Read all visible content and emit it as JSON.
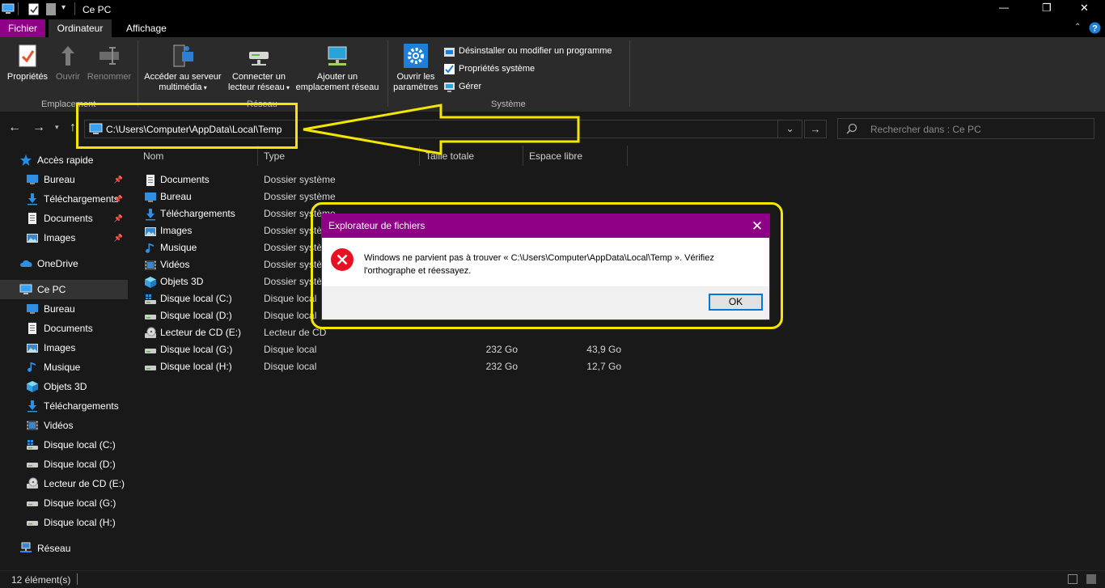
{
  "window": {
    "title": "Ce PC",
    "controls": {
      "minimize": "—",
      "restore": "❐",
      "close": "✕"
    }
  },
  "ribbon_tabs": [
    "Fichier",
    "Ordinateur",
    "Affichage"
  ],
  "ribbon": {
    "location": {
      "group_label": "Emplacement",
      "properties": "Propriétés",
      "open": "Ouvrir",
      "rename": "Renommer"
    },
    "network": {
      "group_label": "Réseau",
      "media_server_line1": "Accéder au serveur",
      "media_server_line2": "multimédia",
      "map_drive_line1": "Connecter un",
      "map_drive_line2": "lecteur réseau",
      "add_location_line1": "Ajouter un",
      "add_location_line2": "emplacement réseau"
    },
    "system": {
      "group_label": "Système",
      "open_settings_line1": "Ouvrir les",
      "open_settings_line2": "paramètres",
      "uninstall": "Désinstaller ou modifier un programme",
      "sys_props": "Propriétés système",
      "manage": "Gérer"
    }
  },
  "address": {
    "path": "C:\\Users\\Computer\\AppData\\Local\\Temp",
    "search_placeholder": "Rechercher dans : Ce PC"
  },
  "nav_pane": [
    {
      "label": "Accès rapide",
      "icon": "star-icon",
      "level": 0,
      "pinned": false
    },
    {
      "label": "Bureau",
      "icon": "desktop-icon",
      "level": 1,
      "pinned": true
    },
    {
      "label": "Téléchargements",
      "icon": "download-icon",
      "level": 1,
      "pinned": true
    },
    {
      "label": "Documents",
      "icon": "document-icon",
      "level": 1,
      "pinned": true
    },
    {
      "label": "Images",
      "icon": "image-icon",
      "level": 1,
      "pinned": true
    },
    {
      "label": "OneDrive",
      "icon": "cloud-icon",
      "level": 0,
      "pinned": false
    },
    {
      "label": "Ce PC",
      "icon": "computer-icon",
      "level": 0,
      "pinned": false,
      "selected": true
    },
    {
      "label": "Bureau",
      "icon": "desktop-icon",
      "level": 1,
      "pinned": false
    },
    {
      "label": "Documents",
      "icon": "document-icon",
      "level": 1,
      "pinned": false
    },
    {
      "label": "Images",
      "icon": "image-icon",
      "level": 1,
      "pinned": false
    },
    {
      "label": "Musique",
      "icon": "music-icon",
      "level": 1,
      "pinned": false
    },
    {
      "label": "Objets 3D",
      "icon": "cube-icon",
      "level": 1,
      "pinned": false
    },
    {
      "label": "Téléchargements",
      "icon": "download-icon",
      "level": 1,
      "pinned": false
    },
    {
      "label": "Vidéos",
      "icon": "video-icon",
      "level": 1,
      "pinned": false
    },
    {
      "label": "Disque local (C:)",
      "icon": "windows-drive-icon",
      "level": 1,
      "pinned": false
    },
    {
      "label": "Disque local (D:)",
      "icon": "drive-icon",
      "level": 1,
      "pinned": false
    },
    {
      "label": "Lecteur de CD (E:)",
      "icon": "cd-drive-icon",
      "level": 1,
      "pinned": false
    },
    {
      "label": "Disque local (G:)",
      "icon": "drive-icon",
      "level": 1,
      "pinned": false
    },
    {
      "label": "Disque local (H:)",
      "icon": "drive-icon",
      "level": 1,
      "pinned": false
    },
    {
      "label": "Réseau",
      "icon": "network-icon",
      "level": 0,
      "pinned": false
    }
  ],
  "columns": [
    "Nom",
    "Type",
    "Taille totale",
    "Espace libre"
  ],
  "items": [
    {
      "name": "Documents",
      "type": "Dossier système",
      "total": "",
      "free": "",
      "icon": "document-icon"
    },
    {
      "name": "Bureau",
      "type": "Dossier système",
      "total": "",
      "free": "",
      "icon": "desktop-icon"
    },
    {
      "name": "Téléchargements",
      "type": "Dossier système",
      "total": "",
      "free": "",
      "icon": "download-icon"
    },
    {
      "name": "Images",
      "type": "Dossier système",
      "total": "",
      "free": "",
      "icon": "image-icon"
    },
    {
      "name": "Musique",
      "type": "Dossier système",
      "total": "",
      "free": "",
      "icon": "music-icon"
    },
    {
      "name": "Vidéos",
      "type": "Dossier système",
      "total": "",
      "free": "",
      "icon": "video-icon"
    },
    {
      "name": "Objets 3D",
      "type": "Dossier système",
      "total": "",
      "free": "",
      "icon": "cube-icon"
    },
    {
      "name": "Disque local (C:)",
      "type": "Disque local",
      "total": "",
      "free": "",
      "icon": "windows-drive-icon"
    },
    {
      "name": "Disque local (D:)",
      "type": "Disque local",
      "total": "",
      "free": "",
      "icon": "drive-icon"
    },
    {
      "name": "Lecteur de CD (E:)",
      "type": "Lecteur de CD",
      "total": "",
      "free": "",
      "icon": "cd-drive-icon"
    },
    {
      "name": "Disque local (G:)",
      "type": "Disque local",
      "total": "232 Go",
      "free": "43,9 Go",
      "icon": "drive-icon"
    },
    {
      "name": "Disque local (H:)",
      "type": "Disque local",
      "total": "232 Go",
      "free": "12,7 Go",
      "icon": "drive-icon"
    }
  ],
  "status": {
    "count": "12 élément(s)"
  },
  "dialog": {
    "title": "Explorateur de fichiers",
    "message": "Windows ne parvient pas à trouver « C:\\Users\\Computer\\AppData\\Local\\Temp ». Vérifiez l'orthographe et réessayez.",
    "ok": "OK"
  },
  "colors": {
    "accent_magenta": "#8e0085",
    "highlight_yellow": "#f5e600",
    "dark_bg": "#191919",
    "ribbon_bg": "#2b2b2b",
    "error_red": "#e81123"
  }
}
